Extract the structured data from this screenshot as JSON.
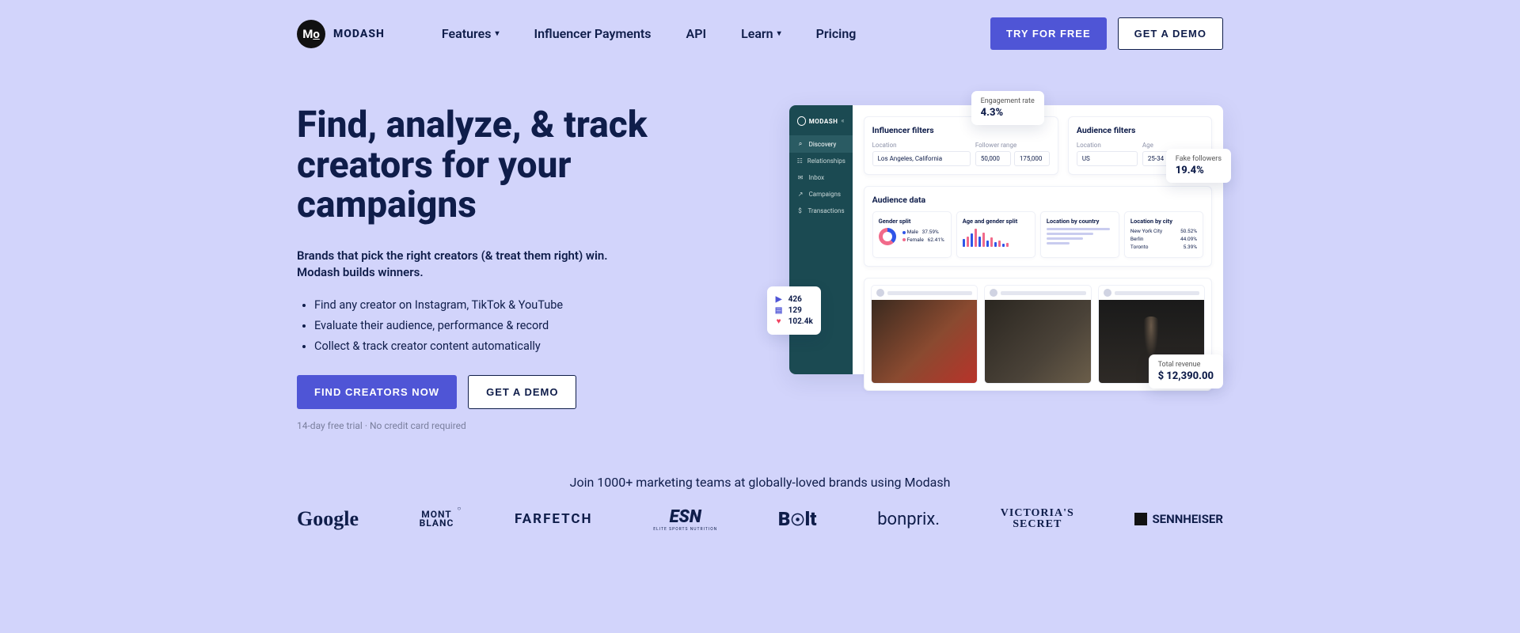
{
  "nav": {
    "brand": "MODASH",
    "items": [
      "Features",
      "Influencer Payments",
      "API",
      "Learn",
      "Pricing"
    ],
    "try": "TRY FOR FREE",
    "demo": "GET A DEMO"
  },
  "hero": {
    "title": "Find, analyze, & track creators for your campaigns",
    "subtitle": "Brands that pick the right creators (& treat them right) win. Modash builds winners.",
    "bullets": [
      "Find any creator on Instagram, TikTok & YouTube",
      "Evaluate their audience, performance & record",
      "Collect & track creator content automatically"
    ],
    "cta_primary": "FIND CREATORS NOW",
    "cta_secondary": "GET A DEMO",
    "fine": "14-day free trial · No credit card required"
  },
  "mock": {
    "side_brand": "MODASH",
    "side_items": [
      "Discovery",
      "Relationships",
      "Inbox",
      "Campaigns",
      "Transactions"
    ],
    "influencer_filters": {
      "title": "Influencer filters",
      "location_label": "Location",
      "location": "Los Angeles, California",
      "range_label": "Follower range",
      "range_min": "50,000",
      "range_max": "175,000"
    },
    "audience_filters": {
      "title": "Audience filters",
      "location_label": "Location",
      "location": "US",
      "age_label": "Age",
      "age": "25-34"
    },
    "audience_data": {
      "title": "Audience data",
      "gender": {
        "title": "Gender split",
        "male_label": "Male",
        "male": "37.59%",
        "female_label": "Female",
        "female": "62.41%"
      },
      "age_gender": {
        "title": "Age and gender split"
      },
      "country": {
        "title": "Location by country"
      },
      "city": {
        "title": "Location by city",
        "rows": [
          {
            "name": "New York City",
            "val": "50.52%"
          },
          {
            "name": "Berlin",
            "val": "44.09%"
          },
          {
            "name": "Toronto",
            "val": "5.39%"
          }
        ]
      }
    },
    "bubbles": {
      "engagement": {
        "label": "Engagement rate",
        "value": "4.3%"
      },
      "fake": {
        "label": "Fake followers",
        "value": "19.4%"
      },
      "revenue": {
        "label": "Total revenue",
        "value": "$  12,390.00"
      },
      "metrics": {
        "plays": "426",
        "comments": "129",
        "likes": "102.4k"
      }
    }
  },
  "brands": {
    "heading": "Join 1000+ marketing teams at globally-loved brands using Modash",
    "list": [
      "Google",
      "MONT BLANC",
      "FARFETCH",
      "ESN",
      "Bolt",
      "bonprix.",
      "VICTORIA'S SECRET",
      "SENNHEISER"
    ]
  }
}
